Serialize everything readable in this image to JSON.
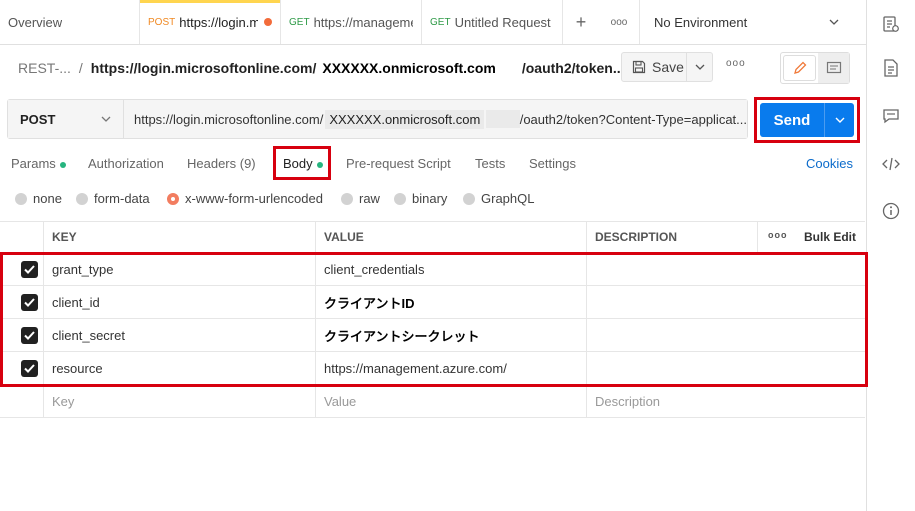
{
  "tabs": [
    {
      "label": "Overview",
      "method": ""
    },
    {
      "label": "https://login.mic",
      "method": "POST",
      "unsaved": true,
      "active": true
    },
    {
      "label": "https://managemen",
      "method": "GET"
    },
    {
      "label": "Untitled Request",
      "method": "GET"
    }
  ],
  "tabbar": {
    "new_tab": "+",
    "more": "ooo",
    "environment": "No Environment"
  },
  "breadcrumb": {
    "collection": "REST-...",
    "separator": "/",
    "url_prefix": "https://login.microsoftonline.com/",
    "tenant": "XXXXXX.onmicrosoft.com",
    "url_suffix": "/oauth2/token..."
  },
  "toolbar": {
    "save_label": "Save",
    "more": "ooo"
  },
  "request": {
    "method": "POST",
    "url_prefix": "https://login.microsoftonline.com/",
    "tenant": "XXXXXX.onmicrosoft.com",
    "url_suffix": "/oauth2/token?Content-Type=applicat..."
  },
  "send": {
    "label": "Send"
  },
  "req_tabs": {
    "params": "Params",
    "authorization": "Authorization",
    "headers": "Headers (9)",
    "body": "Body",
    "prerequest": "Pre-request Script",
    "tests": "Tests",
    "settings": "Settings",
    "cookies": "Cookies"
  },
  "body_types": {
    "none": "none",
    "form_data": "form-data",
    "urlencoded": "x-www-form-urlencoded",
    "raw": "raw",
    "binary": "binary",
    "graphql": "GraphQL",
    "selected": "x-www-form-urlencoded"
  },
  "table": {
    "headers": {
      "key": "KEY",
      "value": "VALUE",
      "description": "DESCRIPTION",
      "more": "ooo",
      "bulk_edit": "Bulk Edit"
    },
    "rows": [
      {
        "key": "grant_type",
        "value": "client_credentials",
        "description": "",
        "checked": true
      },
      {
        "key": "client_id",
        "value": "クライアントID",
        "description": "",
        "checked": true
      },
      {
        "key": "client_secret",
        "value": "クライアントシークレット",
        "description": "",
        "checked": true
      },
      {
        "key": "resource",
        "value": "https://management.azure.com/",
        "description": "",
        "checked": true
      }
    ],
    "placeholder": {
      "key": "Key",
      "value": "Value",
      "description": "Description"
    }
  },
  "colors": {
    "accent": "#097bed",
    "highlight": "#d7000f",
    "dot_unsaved": "#f26b3a",
    "dot_active": "#26b47f"
  }
}
